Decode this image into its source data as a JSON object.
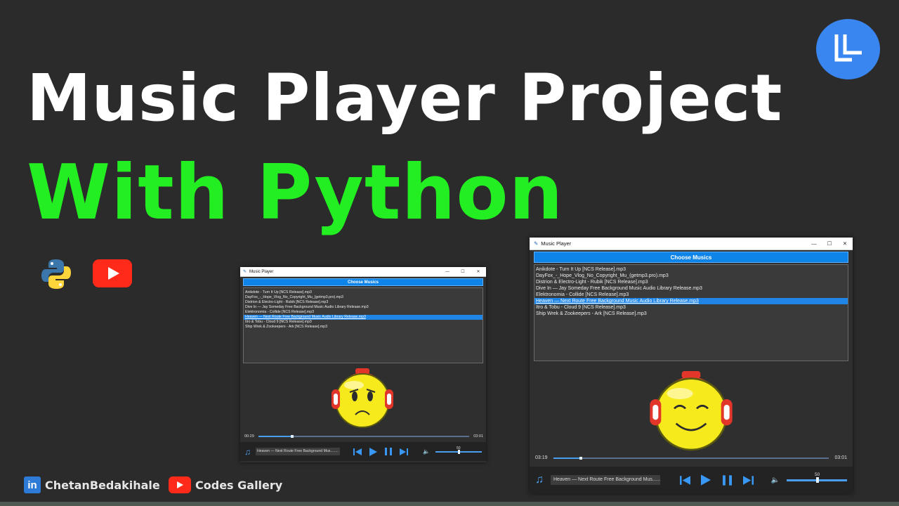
{
  "headline": {
    "line1": "Music Player Project",
    "line2": "With Python"
  },
  "colors": {
    "background": "#2b2b2b",
    "headline_green": "#22ee22",
    "accent_blue": "#0f84e8",
    "youtube_red": "#ff2a1a"
  },
  "icons": [
    "python-logo-icon",
    "youtube-icon",
    "linkedin-icon",
    "brand-logo-icon",
    "music-note-icon",
    "volume-icon"
  ],
  "footer": {
    "linkedin_badge": "in",
    "linkedin_name": "ChetanBedakihale",
    "youtube_channel": "Codes Gallery"
  },
  "players": {
    "small": {
      "window_title": "Music Player",
      "controls": {
        "minimize": "—",
        "maximize": "☐",
        "close": "✕"
      },
      "choose_button": "Choose Musics",
      "songs": [
        "Anikdote - Turn It Up [NCS Release].mp3",
        "DayFox_-_Hope_Vlog_No_Copyright_Mu_(getmp3.pro).mp3",
        "Distrion & Electro-Light - Rubik [NCS Release].mp3",
        "Dive In — Jay Someday  Free Background Music  Audio Library Release.mp3",
        "Elektronomia - Collide [NCS Release].mp3",
        "Heaven — Next Route  Free Background Music  Audio Library Release.mp3",
        "Itro & Tobu - Cloud 9 [NCS Release].mp3",
        "Ship Wrek & Zookeepers - Ark [NCS Release].mp3"
      ],
      "selected_index": 5,
      "mood": "sad",
      "elapsed": "00:29",
      "duration": "03:01",
      "progress": 0.16,
      "now_playing": "Heaven — Next Route  Free Background Mus........",
      "volume": "50"
    },
    "large": {
      "window_title": "Music Player",
      "controls": {
        "minimize": "—",
        "maximize": "☐",
        "close": "✕"
      },
      "choose_button": "Choose Musics",
      "songs": [
        "Anikdote - Turn It Up [NCS Release].mp3",
        "DayFox_-_Hope_Vlog_No_Copyright_Mu_(getmp3.pro).mp3",
        "Distrion & Electro-Light - Rubik [NCS Release].mp3",
        "Dive In — Jay Someday  Free Background Music  Audio Library Release.mp3",
        "Elektronomia - Collide [NCS Release].mp3",
        "Heaven — Next Route  Free Background Music  Audio Library Release.mp3",
        "Itro & Tobu - Cloud 9 [NCS Release].mp3",
        "Ship Wrek & Zookeepers - Ark [NCS Release].mp3"
      ],
      "selected_index": 5,
      "mood": "happy",
      "elapsed": "03:19",
      "duration": "03:01",
      "progress": 0.1,
      "now_playing": "Heaven — Next Route  Free Background Mus........",
      "volume": "50"
    }
  }
}
